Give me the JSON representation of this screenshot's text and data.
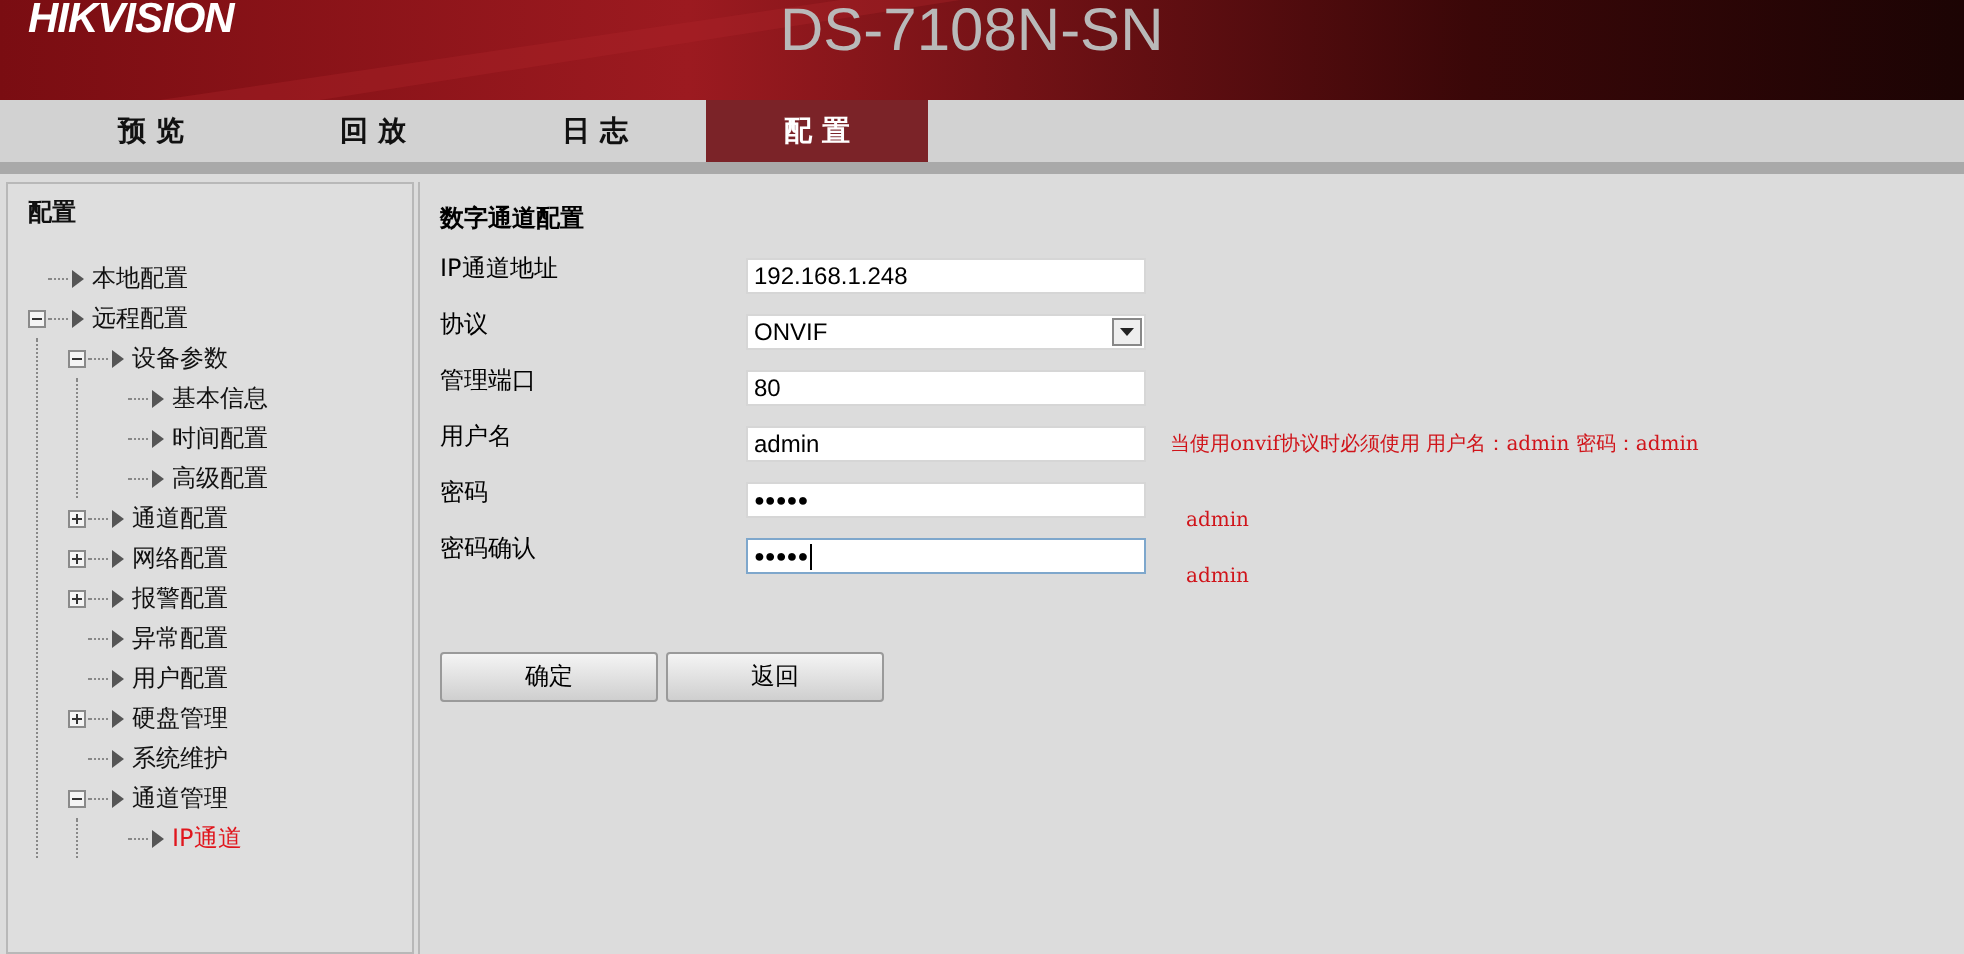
{
  "header": {
    "logo": "HIKVISION",
    "title": "DS-7108N-SN"
  },
  "tabs": [
    {
      "label": "预 览",
      "selected": false
    },
    {
      "label": "回 放",
      "selected": false
    },
    {
      "label": "日 志",
      "selected": false
    },
    {
      "label": "配 置",
      "selected": true
    }
  ],
  "sidebar": {
    "title": "配置",
    "tree": [
      {
        "label": "本地配置",
        "selected": false
      },
      {
        "label": "远程配置",
        "selected": false,
        "expanded": true,
        "children": [
          {
            "label": "设备参数",
            "selected": false,
            "expanded": true,
            "children": [
              {
                "label": "基本信息",
                "selected": false
              },
              {
                "label": "时间配置",
                "selected": false
              },
              {
                "label": "高级配置",
                "selected": false
              }
            ]
          },
          {
            "label": "通道配置",
            "selected": false,
            "expanded": false
          },
          {
            "label": "网络配置",
            "selected": false,
            "expanded": false
          },
          {
            "label": "报警配置",
            "selected": false,
            "expanded": false
          },
          {
            "label": "异常配置",
            "selected": false
          },
          {
            "label": "用户配置",
            "selected": false
          },
          {
            "label": "硬盘管理",
            "selected": false,
            "expanded": false
          },
          {
            "label": "系统维护",
            "selected": false
          },
          {
            "label": "通道管理",
            "selected": false,
            "expanded": true,
            "children": [
              {
                "label": "IP通道",
                "selected": true
              }
            ]
          }
        ]
      }
    ]
  },
  "form": {
    "title": "数字通道配置",
    "fields": [
      {
        "kind": "text",
        "label": "IP通道地址",
        "value": "192.168.1.248"
      },
      {
        "kind": "select",
        "label": "协议",
        "value": "ONVIF"
      },
      {
        "kind": "text",
        "label": "管理端口",
        "value": "80"
      },
      {
        "kind": "text",
        "label": "用户名",
        "value": "admin",
        "note": "当使用onvif协议时必须使用 用户名：admin 密码：admin"
      },
      {
        "kind": "password",
        "label": "密码",
        "value": "●●●●●",
        "note": "admin"
      },
      {
        "kind": "password",
        "label": "密码确认",
        "value": "●●●●●",
        "focused": true,
        "note": "admin"
      }
    ],
    "buttons": [
      "确定",
      "返回"
    ]
  }
}
